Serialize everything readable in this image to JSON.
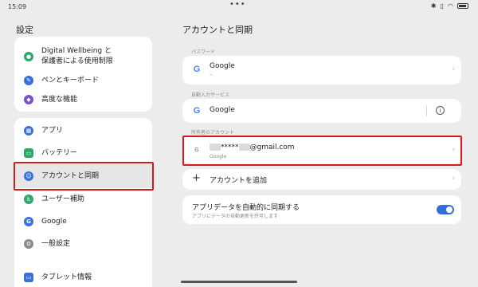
{
  "status_bar": {
    "time": "15:09",
    "dots": "•••"
  },
  "left_panel": {
    "title": "設定",
    "group1": [
      {
        "label_line1": "Digital Wellbeing と",
        "label_line2": "保護者による使用制限",
        "icon": "wellbeing-icon",
        "color": "#2fa86a"
      },
      {
        "label": "ペンとキーボード",
        "icon": "pen-icon",
        "color": "#3b6fd9"
      },
      {
        "label": "高度な機能",
        "icon": "advanced-features-icon",
        "color": "#7a52c8"
      }
    ],
    "group2": [
      {
        "label": "アプリ",
        "icon": "apps-icon",
        "color": "#3b6fd9"
      },
      {
        "label": "バッテリー",
        "icon": "battery-icon",
        "color": "#2fa86a"
      },
      {
        "label": "アカウントと同期",
        "icon": "account-icon",
        "color": "#3b6fd9",
        "selected": true
      },
      {
        "label": "ユーザー補助",
        "icon": "accessibility-icon",
        "color": "#2fa86a"
      },
      {
        "label": "Google",
        "icon": "google-icon",
        "color": "#3b6fd9"
      },
      {
        "label": "一般設定",
        "icon": "general-settings-icon",
        "color": "#8a8a8a"
      }
    ],
    "group3": [
      {
        "label": "タブレット情報",
        "icon": "tablet-info-icon",
        "color": "#3b6fd9"
      }
    ]
  },
  "right_panel": {
    "title": "アカウントと同期",
    "password_section": {
      "label": "パスワード",
      "provider": "Google",
      "sub": "–"
    },
    "autofill_section": {
      "label": "自動入力サービス",
      "provider": "Google"
    },
    "owner_section": {
      "label": "所有者のアカウント",
      "email_stars": "*****",
      "email_suffix": "@gmail.com",
      "account_type": "Google"
    },
    "add_account": {
      "label": "アカウントを追加"
    },
    "sync": {
      "title": "アプリデータを自動的に同期する",
      "sub": "アプリにデータの自動更新を許可します",
      "enabled": true
    }
  },
  "colors": {
    "highlight_red": "#d41a1a",
    "toggle_blue": "#2f6fd6"
  }
}
